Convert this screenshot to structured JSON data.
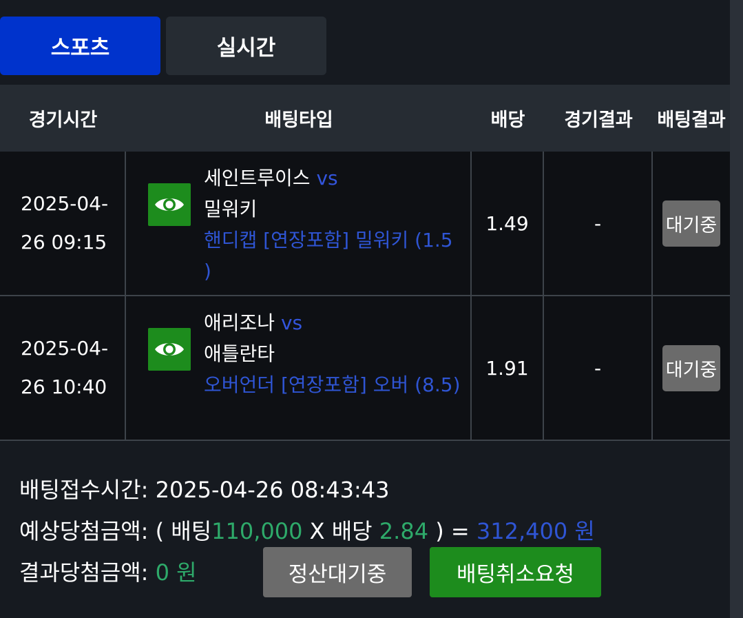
{
  "tabs": {
    "sports": "스포츠",
    "live": "실시간"
  },
  "table": {
    "headers": {
      "time": "경기시간",
      "bet_type": "배팅타입",
      "odds": "배당",
      "game_result": "경기결과",
      "bet_result": "배팅결과"
    },
    "rows": [
      {
        "time_line1": "2025-04-",
        "time_line2": "26 09:15",
        "home": "세인트루이스",
        "vs": "vs",
        "away": "밀워키",
        "bet_desc": "핸디캡 [연장포함] 밀워키 (1.5 )",
        "odds": "1.49",
        "game_result": "-",
        "status": "대기중"
      },
      {
        "time_line1": "2025-04-",
        "time_line2": "26 10:40",
        "home": "애리조나",
        "vs": "vs",
        "away": "애틀란타",
        "bet_desc": "오버언더 [연장포함] 오버 (8.5)",
        "odds": "1.91",
        "game_result": "-",
        "status": "대기중"
      }
    ]
  },
  "summary": {
    "received_label": "배팅접수시간:",
    "received_time": "2025-04-26 08:43:43",
    "expected_label": "예상당첨금액:",
    "paren_open": "(",
    "bet_label": "배팅",
    "bet_amount": "110,000",
    "times": "X",
    "odds_label": "배당",
    "total_odds": "2.84",
    "paren_close": ")",
    "equals": "=",
    "expected_amount": "312,400",
    "won": "원",
    "result_label": "결과당첨금액:",
    "result_amount": "0",
    "result_won": "원"
  },
  "buttons": {
    "pending": "정산대기중",
    "cancel": "배팅취소요청"
  },
  "colors": {
    "primary_tab": "#0033cc",
    "accent_green": "#1d8c1d",
    "accent_blue": "#2f55d4",
    "money_green": "#2eaa6a"
  }
}
